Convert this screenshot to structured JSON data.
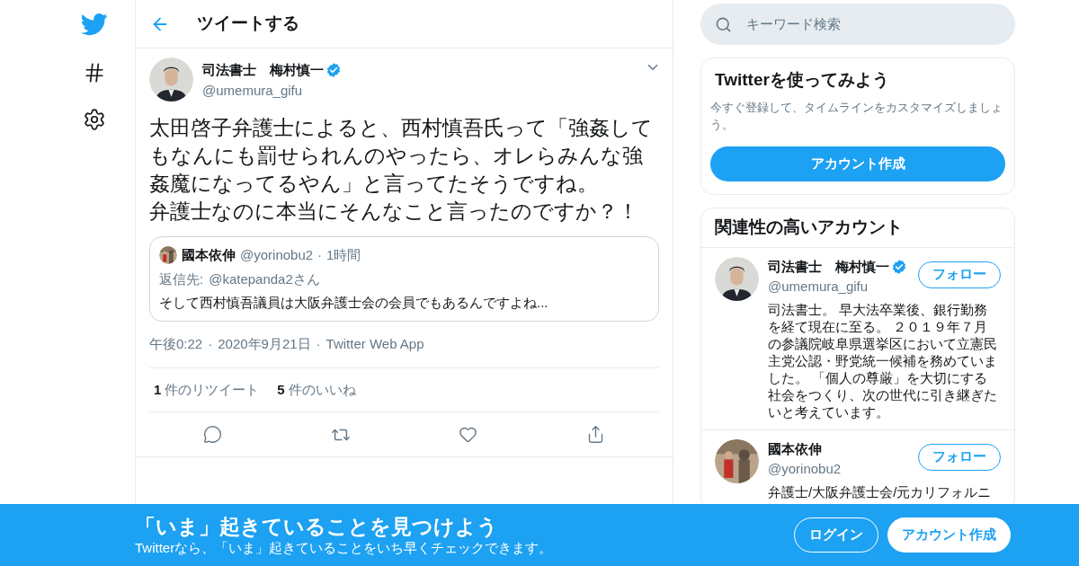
{
  "header": {
    "title": "ツイートする"
  },
  "tweet": {
    "author": {
      "name": "司法書士　梅村慎一",
      "handle": "@umemura_gifu",
      "verified": true
    },
    "paragraphs": [
      "太田啓子弁護士によると、西村慎吾氏って「強姦してもなんにも罰せられんのやったら、オレらみんな強姦魔になってるやん」と言ってたそうですね。",
      "弁護士なのに本当にそんなこと言ったのですか？！"
    ],
    "quote": {
      "name": "國本依伸",
      "handle": "@yorinobu2",
      "separator": "·",
      "time": "1時間",
      "reply_label": "返信先:",
      "reply_to": "@katepanda2さん",
      "text": "そして西村慎吾議員は大阪弁護士会の会員でもあるんですよね..."
    },
    "meta": [
      {
        "text": "午後0:22"
      },
      {
        "text": "·"
      },
      {
        "text": "2020年9月21日"
      },
      {
        "text": "·"
      },
      {
        "text": "Twitter Web App"
      }
    ],
    "stats": [
      {
        "count": "1",
        "label": "件のリツイート"
      },
      {
        "count": "5",
        "label": "件のいいね"
      }
    ]
  },
  "sidebar": {
    "search": {
      "placeholder": "キーワード検索"
    },
    "signup_card": {
      "title": "Twitterを使ってみよう",
      "text": "今すぐ登録して、タイムラインをカスタマイズしましょう。",
      "button": "アカウント作成"
    },
    "related": {
      "title": "関連性の高いアカウント",
      "accounts": [
        {
          "name": "司法書士　梅村慎一",
          "handle": "@umemura_gifu",
          "verified": true,
          "button": "フォロー",
          "bio": "司法書士。 早大法卒業後、銀行勤務を経て現在に至る。 ２０１９年７月の参議院岐阜県選挙区において立憲民主党公認・野党統一候補を務めていました。 「個人の尊厳」を大切にする社会をつくり、次の世代に引き継ぎたいと考えています。"
        },
        {
          "name": "國本依伸",
          "handle": "@yorinobu2",
          "verified": false,
          "button": "フォロー",
          "bio": "弁護士/大阪弁護士会/元カリフォルニ"
        }
      ]
    }
  },
  "banner": {
    "title": "「いま」起きていることを見つけよう",
    "subtitle": "Twitterなら、「いま」起きていることをいち早くチェックできます。",
    "login": "ログイン",
    "signup": "アカウント作成"
  }
}
